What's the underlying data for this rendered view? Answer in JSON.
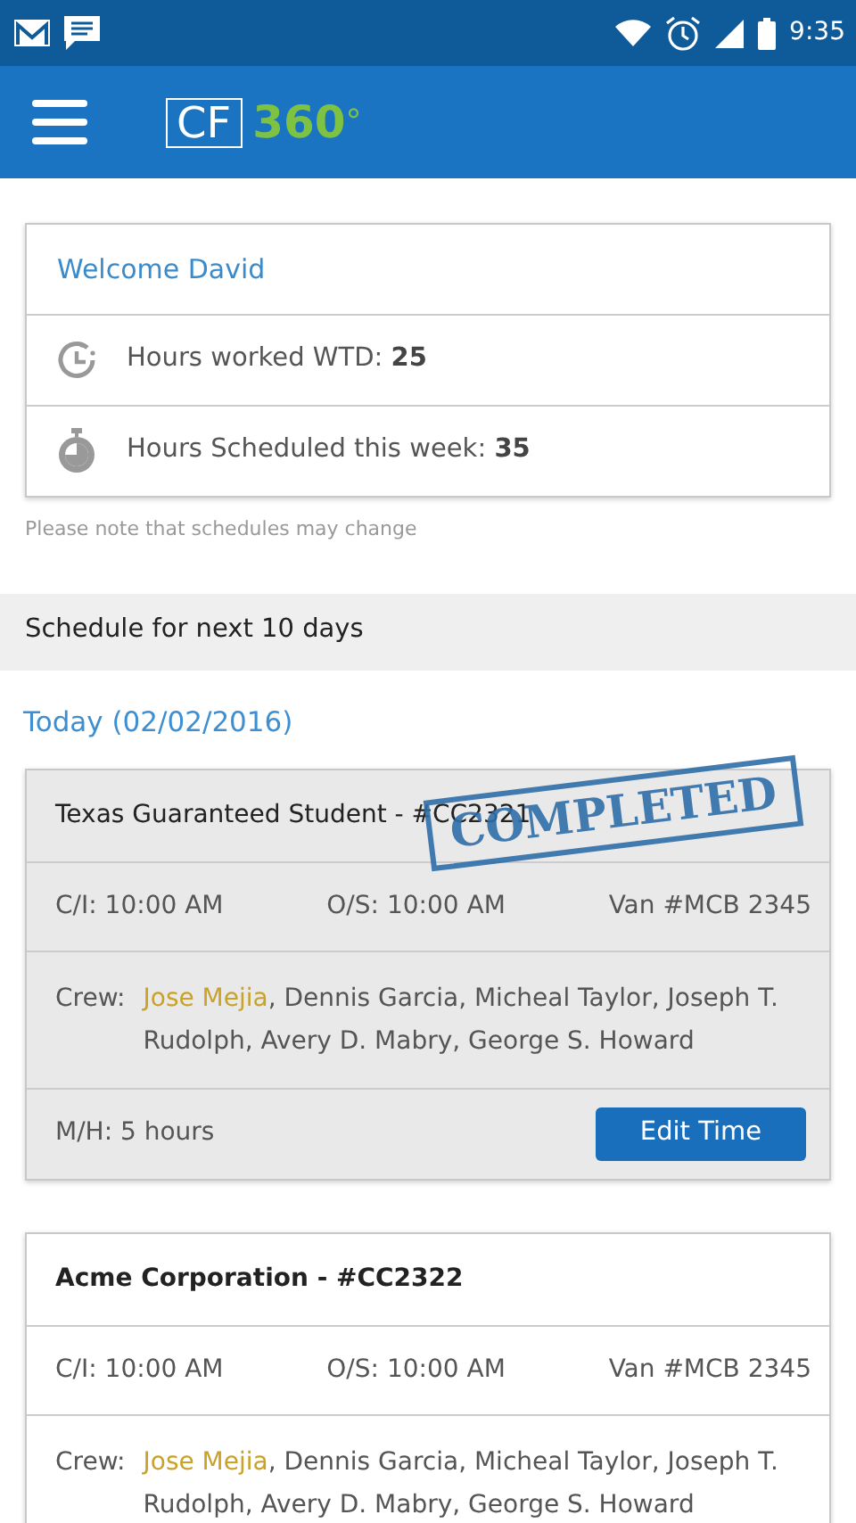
{
  "status_bar": {
    "time": "9:35"
  },
  "app_bar": {
    "logo_box": "CF",
    "logo_text": "360",
    "logo_degree": "°"
  },
  "summary": {
    "welcome": "Welcome David",
    "stats": [
      {
        "kind": "clock",
        "label": "Hours worked WTD: ",
        "value": "25"
      },
      {
        "kind": "stopwatch",
        "label": "Hours Scheduled this week: ",
        "value": "35"
      }
    ],
    "note": "Please note that schedules may change"
  },
  "section_title": "Schedule for next 10 days",
  "day_header": "Today (02/02/2016)",
  "jobs": [
    {
      "title": "Texas Guaranteed Student - #CC2321",
      "completed": true,
      "stamp": "COMPLETED",
      "check_in": "C/I: 10:00 AM",
      "on_site": "O/S: 10:00 AM",
      "van": "Van #MCB 2345",
      "crew_label": "Crew:",
      "crew": [
        {
          "text": "Jose Mejia",
          "lead": true
        },
        {
          "text": ", Dennis Garcia, Micheal Taylor, Joseph T. Rudolph, Avery D. Mabry, George S. Howard",
          "lead": false
        }
      ],
      "man_hours": "M/H: 5 hours",
      "button": "Edit Time"
    },
    {
      "title": "Acme Corporation - #CC2322",
      "completed": false,
      "check_in": "C/I: 10:00 AM",
      "on_site": "O/S: 10:00 AM",
      "van": "Van #MCB 2345",
      "crew_label": "Crew:",
      "crew": [
        {
          "text": "Jose Mejia",
          "lead": true
        },
        {
          "text": ", Dennis Garcia, Micheal Taylor, Joseph T. Rudolph, Avery D. Mabry, George S. Howard",
          "lead": false
        }
      ]
    }
  ]
}
